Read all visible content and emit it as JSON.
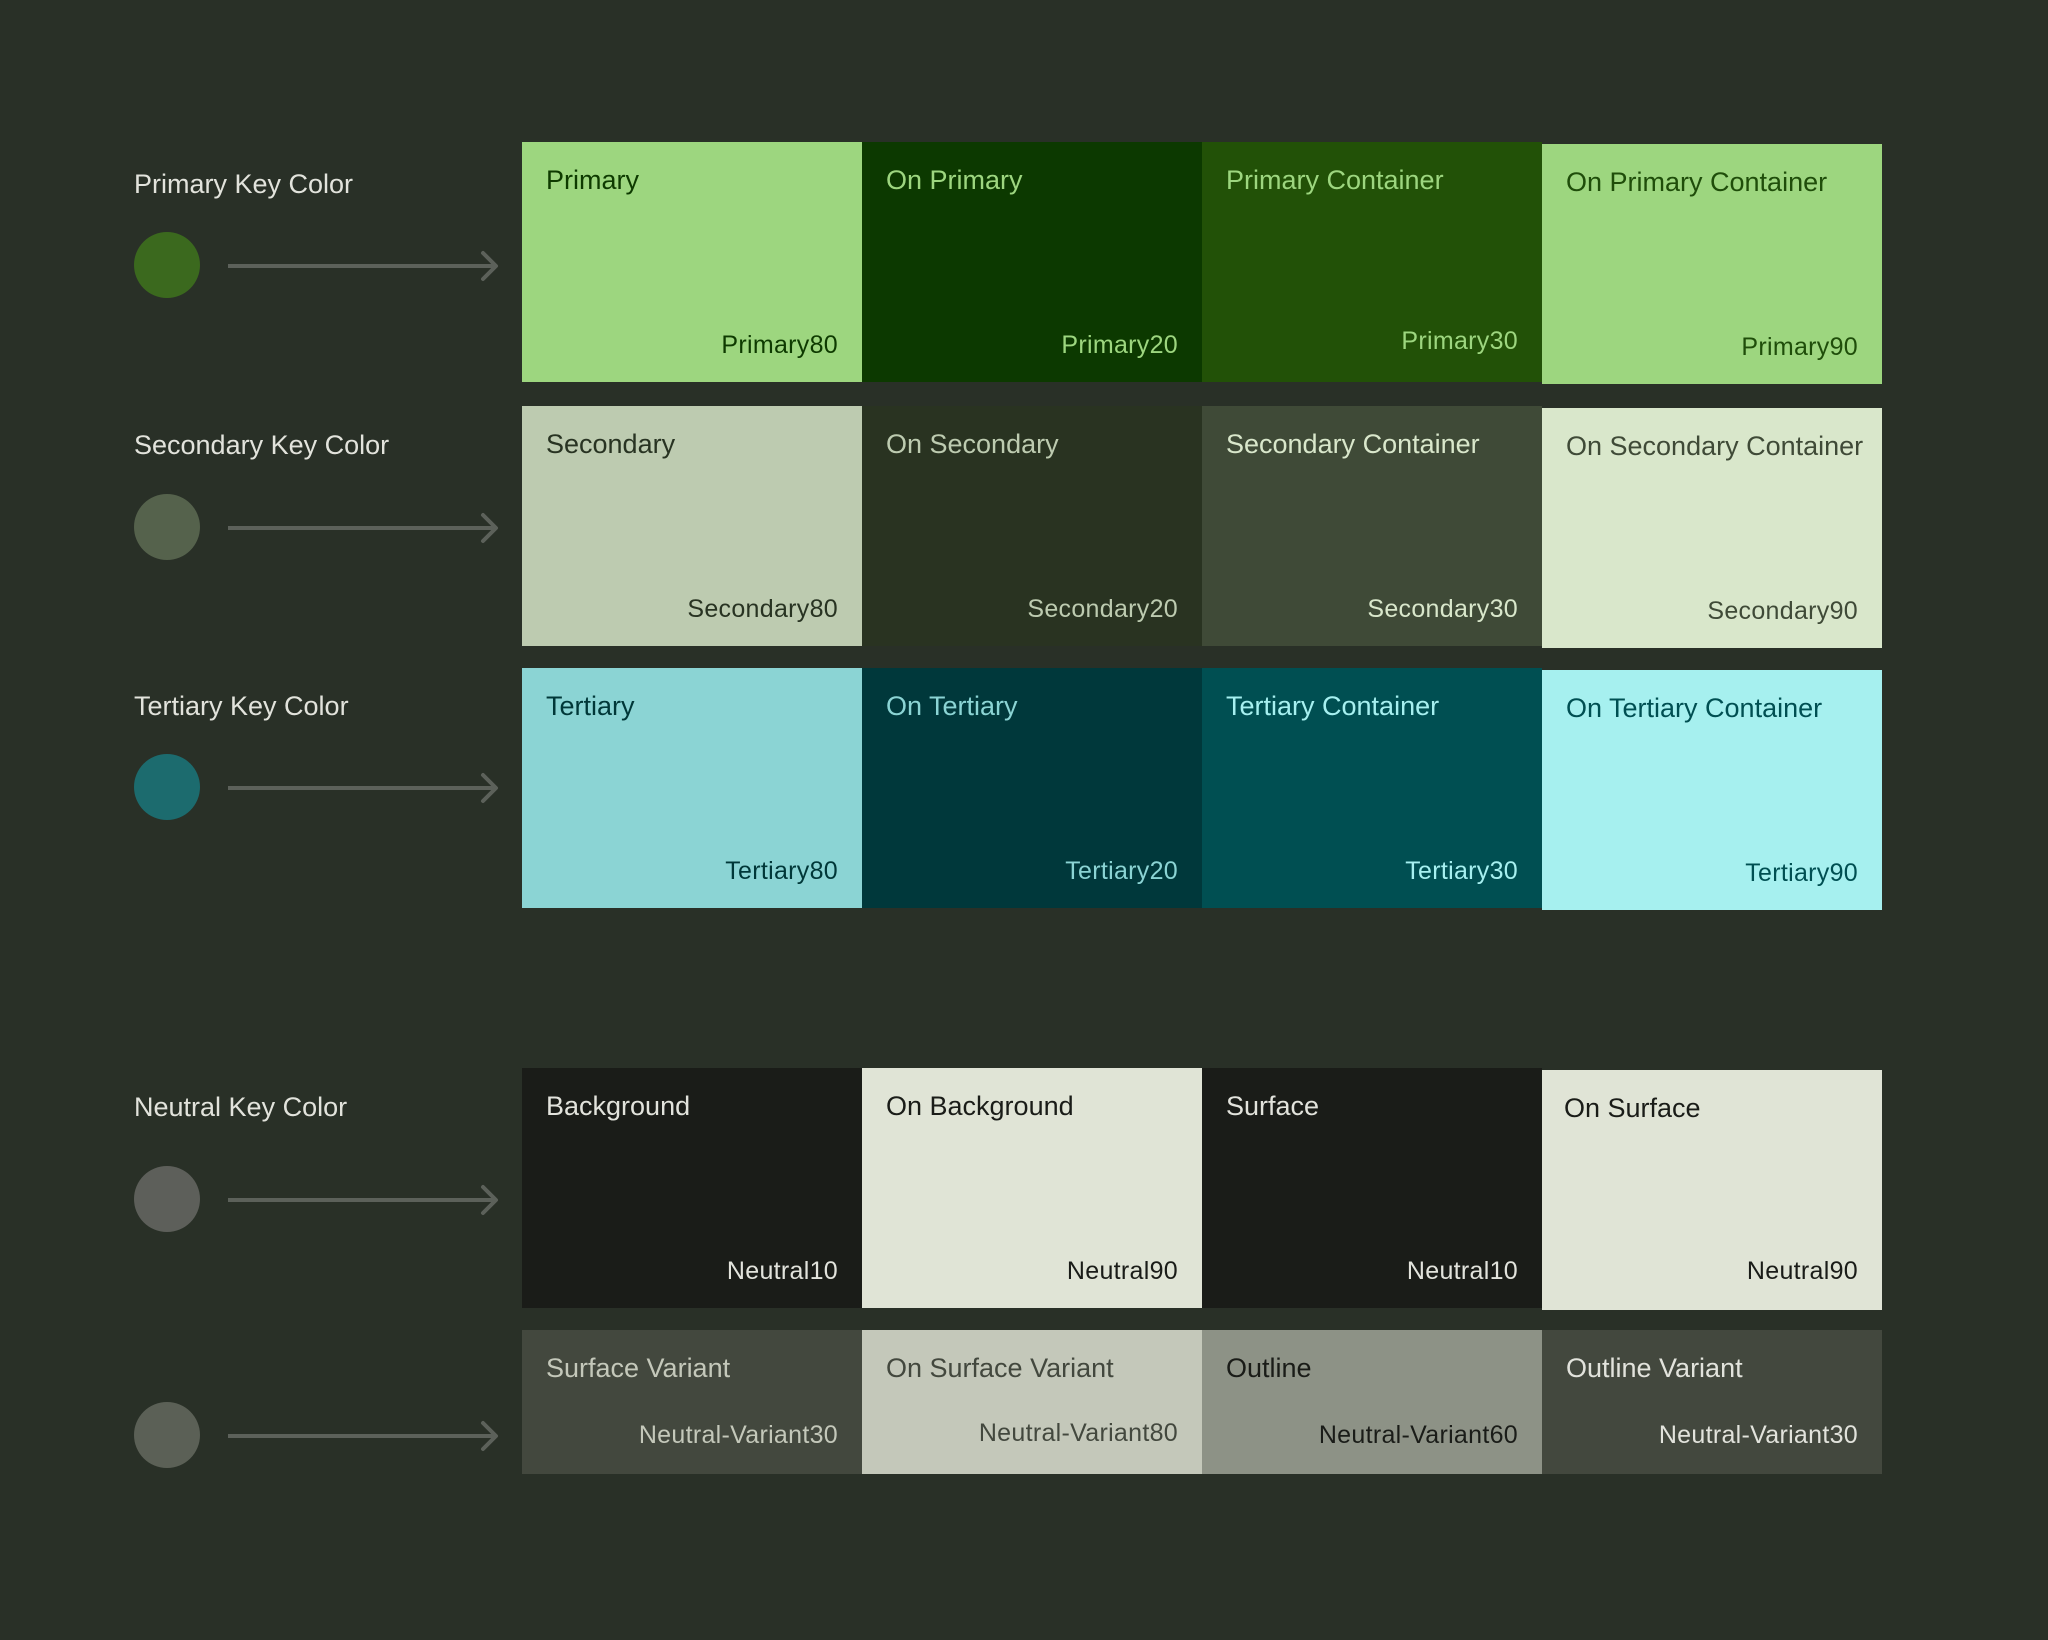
{
  "background": "#293027",
  "groups": [
    {
      "label": "Primary Key Color",
      "key_color": "#3b691e",
      "swatches": [
        {
          "role": "Primary",
          "tone": "Primary80",
          "bg": "#9dd67f",
          "fg": "#0e3a00"
        },
        {
          "role": "On Primary",
          "tone": "Primary20",
          "bg": "#0c3900",
          "fg": "#9dd67f"
        },
        {
          "role": "Primary Container",
          "tone": "Primary30",
          "bg": "#225107",
          "fg": "#9dd67f"
        },
        {
          "role": "On Primary Container",
          "tone": "Primary90",
          "bg": "#9dd67f",
          "fg": "#1f4d0a"
        }
      ]
    },
    {
      "label": "Secondary Key Color",
      "key_color": "#55624c",
      "swatches": [
        {
          "role": "Secondary",
          "tone": "Secondary80",
          "bg": "#bdcbb0",
          "fg": "#283322"
        },
        {
          "role": "On Secondary",
          "tone": "Secondary20",
          "bg": "#293321",
          "fg": "#bdcbb0"
        },
        {
          "role": "Secondary Container",
          "tone": "Secondary30",
          "bg": "#3f4a37",
          "fg": "#d9e7cb"
        },
        {
          "role": "On Secondary Container",
          "tone": "Secondary90",
          "bg": "#d9e7cb",
          "fg": "#3f4a37"
        }
      ]
    },
    {
      "label": "Tertiary Key Color",
      "key_color": "#1c6b6e",
      "swatches": [
        {
          "role": "Tertiary",
          "tone": "Tertiary80",
          "bg": "#8bd4d4",
          "fg": "#003738"
        },
        {
          "role": "On Tertiary",
          "tone": "Tertiary20",
          "bg": "#00383b",
          "fg": "#8bd4d4"
        },
        {
          "role": "Tertiary Container",
          "tone": "Tertiary30",
          "bg": "#004f52",
          "fg": "#a6f0f0"
        },
        {
          "role": "On Tertiary Container",
          "tone": "Tertiary90",
          "bg": "#a6f0ef",
          "fg": "#004f52"
        }
      ]
    },
    {
      "label": "Neutral Key Color",
      "key_color": "#5d5f5a",
      "swatches": [
        {
          "role": "Background",
          "tone": "Neutral10",
          "bg": "#1a1c18",
          "fg": "#e2e3dc"
        },
        {
          "role": "On Background",
          "tone": "Neutral90",
          "bg": "#e0e4d6",
          "fg": "#1a1c18"
        },
        {
          "role": "Surface",
          "tone": "Neutral10",
          "bg": "#1a1c18",
          "fg": "#e2e3dc"
        },
        {
          "role": "On Surface",
          "tone": "Neutral90",
          "bg": "#e0e4d6",
          "fg": "#1a1c18"
        }
      ]
    },
    {
      "label": "",
      "key_color": "#5b6056",
      "swatches": [
        {
          "role": "Surface Variant",
          "tone": "Neutral-Variant30",
          "bg": "#43483e",
          "fg": "#c4c8ba"
        },
        {
          "role": "On Surface Variant",
          "tone": "Neutral-Variant80",
          "bg": "#c4c8ba",
          "fg": "#43483e"
        },
        {
          "role": "Outline",
          "tone": "Neutral-Variant60",
          "bg": "#8d9286",
          "fg": "#1a1c18"
        },
        {
          "role": "Outline Variant",
          "tone": "Neutral-Variant30",
          "bg": "#43483e",
          "fg": "#e2e3dc"
        }
      ]
    }
  ]
}
